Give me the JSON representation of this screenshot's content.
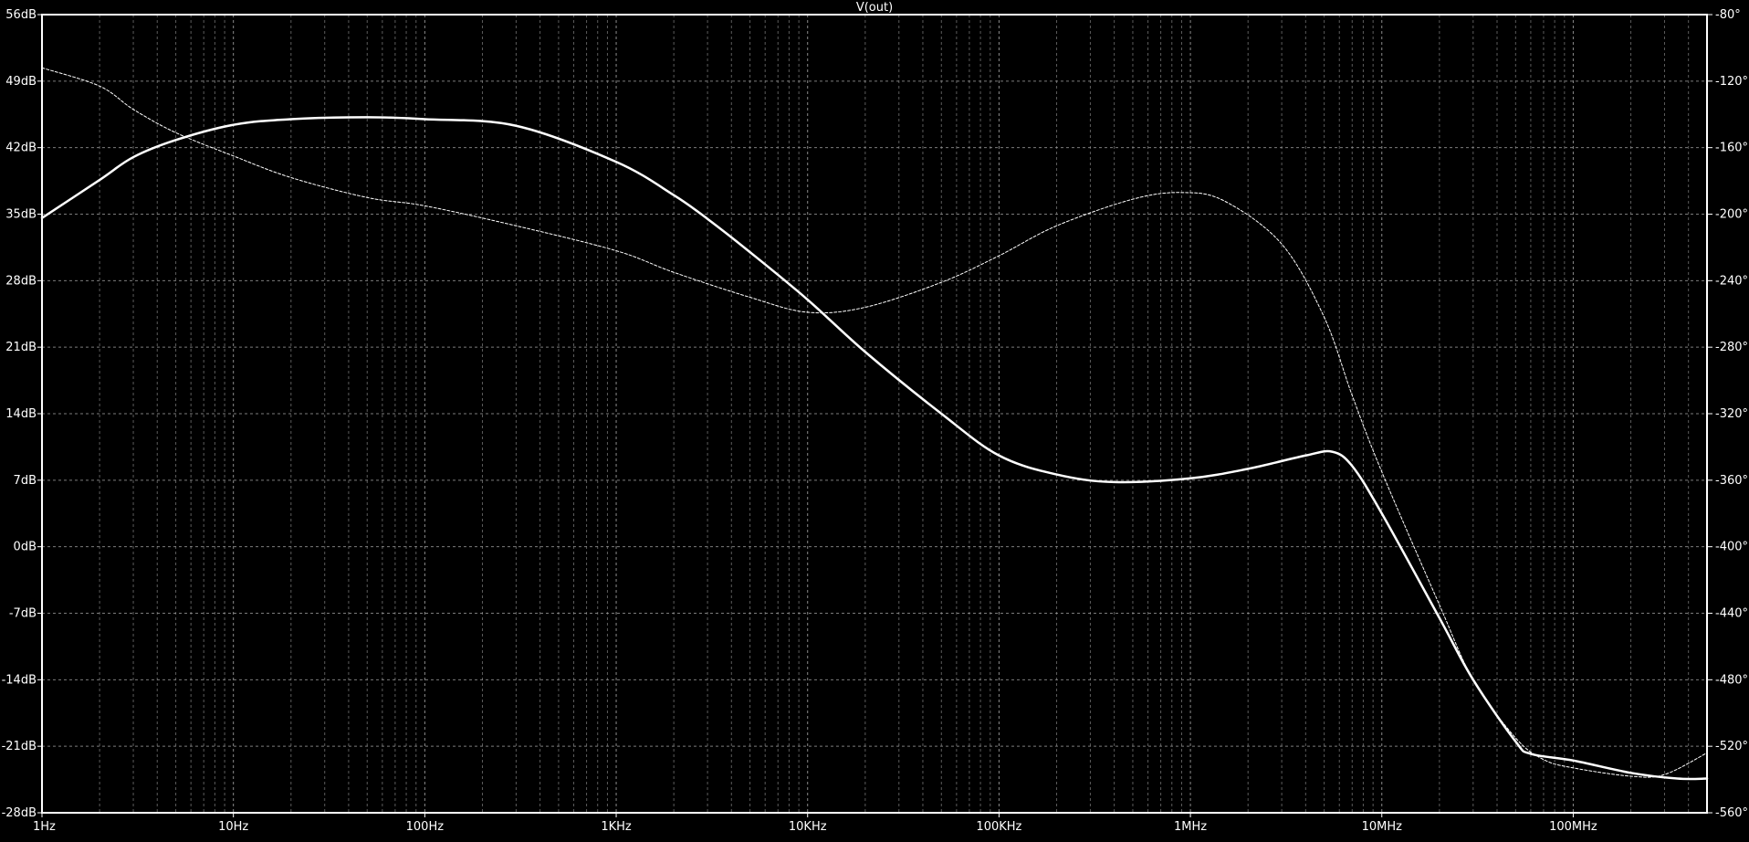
{
  "chart_data": {
    "type": "line",
    "title": "V(out)",
    "x_scale": "log",
    "x_range_hz": [
      1,
      500000000
    ],
    "x_ticks": [
      {
        "value": 1,
        "label": "1Hz"
      },
      {
        "value": 10,
        "label": "10Hz"
      },
      {
        "value": 100,
        "label": "100Hz"
      },
      {
        "value": 1000,
        "label": "1KHz"
      },
      {
        "value": 10000,
        "label": "10KHz"
      },
      {
        "value": 100000,
        "label": "100KHz"
      },
      {
        "value": 1000000,
        "label": "1MHz"
      },
      {
        "value": 10000000,
        "label": "10MHz"
      },
      {
        "value": 100000000,
        "label": "100MHz"
      }
    ],
    "y_left_range": [
      -28,
      56
    ],
    "y_left_ticks": [
      {
        "value": 56,
        "label": "56dB"
      },
      {
        "value": 49,
        "label": "49dB"
      },
      {
        "value": 42,
        "label": "42dB"
      },
      {
        "value": 35,
        "label": "35dB"
      },
      {
        "value": 28,
        "label": "28dB"
      },
      {
        "value": 21,
        "label": "21dB"
      },
      {
        "value": 14,
        "label": "14dB"
      },
      {
        "value": 7,
        "label": "7dB"
      },
      {
        "value": 0,
        "label": "0dB"
      },
      {
        "value": -7,
        "label": "-7dB"
      },
      {
        "value": -14,
        "label": "-14dB"
      },
      {
        "value": -21,
        "label": "-21dB"
      },
      {
        "value": -28,
        "label": "-28dB"
      }
    ],
    "y_right_range": [
      -560,
      -80
    ],
    "y_right_ticks": [
      {
        "value": -80,
        "label": "-80°"
      },
      {
        "value": -120,
        "label": "-120°"
      },
      {
        "value": -160,
        "label": "-160°"
      },
      {
        "value": -200,
        "label": "-200°"
      },
      {
        "value": -240,
        "label": "-240°"
      },
      {
        "value": -280,
        "label": "-280°"
      },
      {
        "value": -320,
        "label": "-320°"
      },
      {
        "value": -360,
        "label": "-360°"
      },
      {
        "value": -400,
        "label": "-400°"
      },
      {
        "value": -440,
        "label": "-440°"
      },
      {
        "value": -480,
        "label": "-480°"
      },
      {
        "value": -520,
        "label": "-520°"
      },
      {
        "value": -560,
        "label": "-560°"
      }
    ],
    "grid": true,
    "colors": {
      "background": "#000000",
      "trace": "#ffffff",
      "grid": "#9a9a9a"
    },
    "series": [
      {
        "quantity": "magnitude",
        "axis": "left",
        "style": "solid",
        "points": [
          [
            1,
            34.6
          ],
          [
            2,
            38.6
          ],
          [
            3,
            41.0
          ],
          [
            5,
            42.8
          ],
          [
            10,
            44.4
          ],
          [
            20,
            45.0
          ],
          [
            50,
            45.2
          ],
          [
            100,
            45.0
          ],
          [
            300,
            44.3
          ],
          [
            1000,
            40.5
          ],
          [
            2000,
            37.0
          ],
          [
            3000,
            34.5
          ],
          [
            5000,
            31.0
          ],
          [
            10000,
            26.0
          ],
          [
            20000,
            20.5
          ],
          [
            50000,
            14.0
          ],
          [
            100000,
            9.6
          ],
          [
            200000,
            7.6
          ],
          [
            400000,
            6.8
          ],
          [
            1000000,
            7.2
          ],
          [
            2000000,
            8.2
          ],
          [
            4000000,
            9.6
          ],
          [
            5500000,
            10.0
          ],
          [
            7000000,
            8.5
          ],
          [
            10000000,
            3.5
          ],
          [
            20000000,
            -7.5
          ],
          [
            30000000,
            -14.0
          ],
          [
            50000000,
            -20.5
          ],
          [
            60000000,
            -21.8
          ],
          [
            100000000,
            -22.5
          ],
          [
            200000000,
            -23.8
          ],
          [
            350000000,
            -24.4
          ],
          [
            500000000,
            -24.4
          ]
        ]
      },
      {
        "quantity": "phase",
        "axis": "right",
        "style": "dashed",
        "points": [
          [
            1,
            -112
          ],
          [
            2,
            -123
          ],
          [
            3,
            -137
          ],
          [
            5,
            -151
          ],
          [
            10,
            -165
          ],
          [
            20,
            -178
          ],
          [
            50,
            -190
          ],
          [
            100,
            -195
          ],
          [
            300,
            -207
          ],
          [
            1000,
            -222
          ],
          [
            2000,
            -235
          ],
          [
            5000,
            -250
          ],
          [
            10000,
            -259
          ],
          [
            20000,
            -256
          ],
          [
            50000,
            -241
          ],
          [
            100000,
            -225
          ],
          [
            200000,
            -207
          ],
          [
            500000,
            -191
          ],
          [
            900000,
            -187
          ],
          [
            1500000,
            -192
          ],
          [
            3000000,
            -218
          ],
          [
            5000000,
            -262
          ],
          [
            7000000,
            -309
          ],
          [
            10000000,
            -355
          ],
          [
            20000000,
            -435
          ],
          [
            30000000,
            -480
          ],
          [
            50000000,
            -515
          ],
          [
            70000000,
            -528
          ],
          [
            100000000,
            -533
          ],
          [
            200000000,
            -538
          ],
          [
            300000000,
            -537
          ],
          [
            500000000,
            -524
          ]
        ]
      }
    ]
  }
}
